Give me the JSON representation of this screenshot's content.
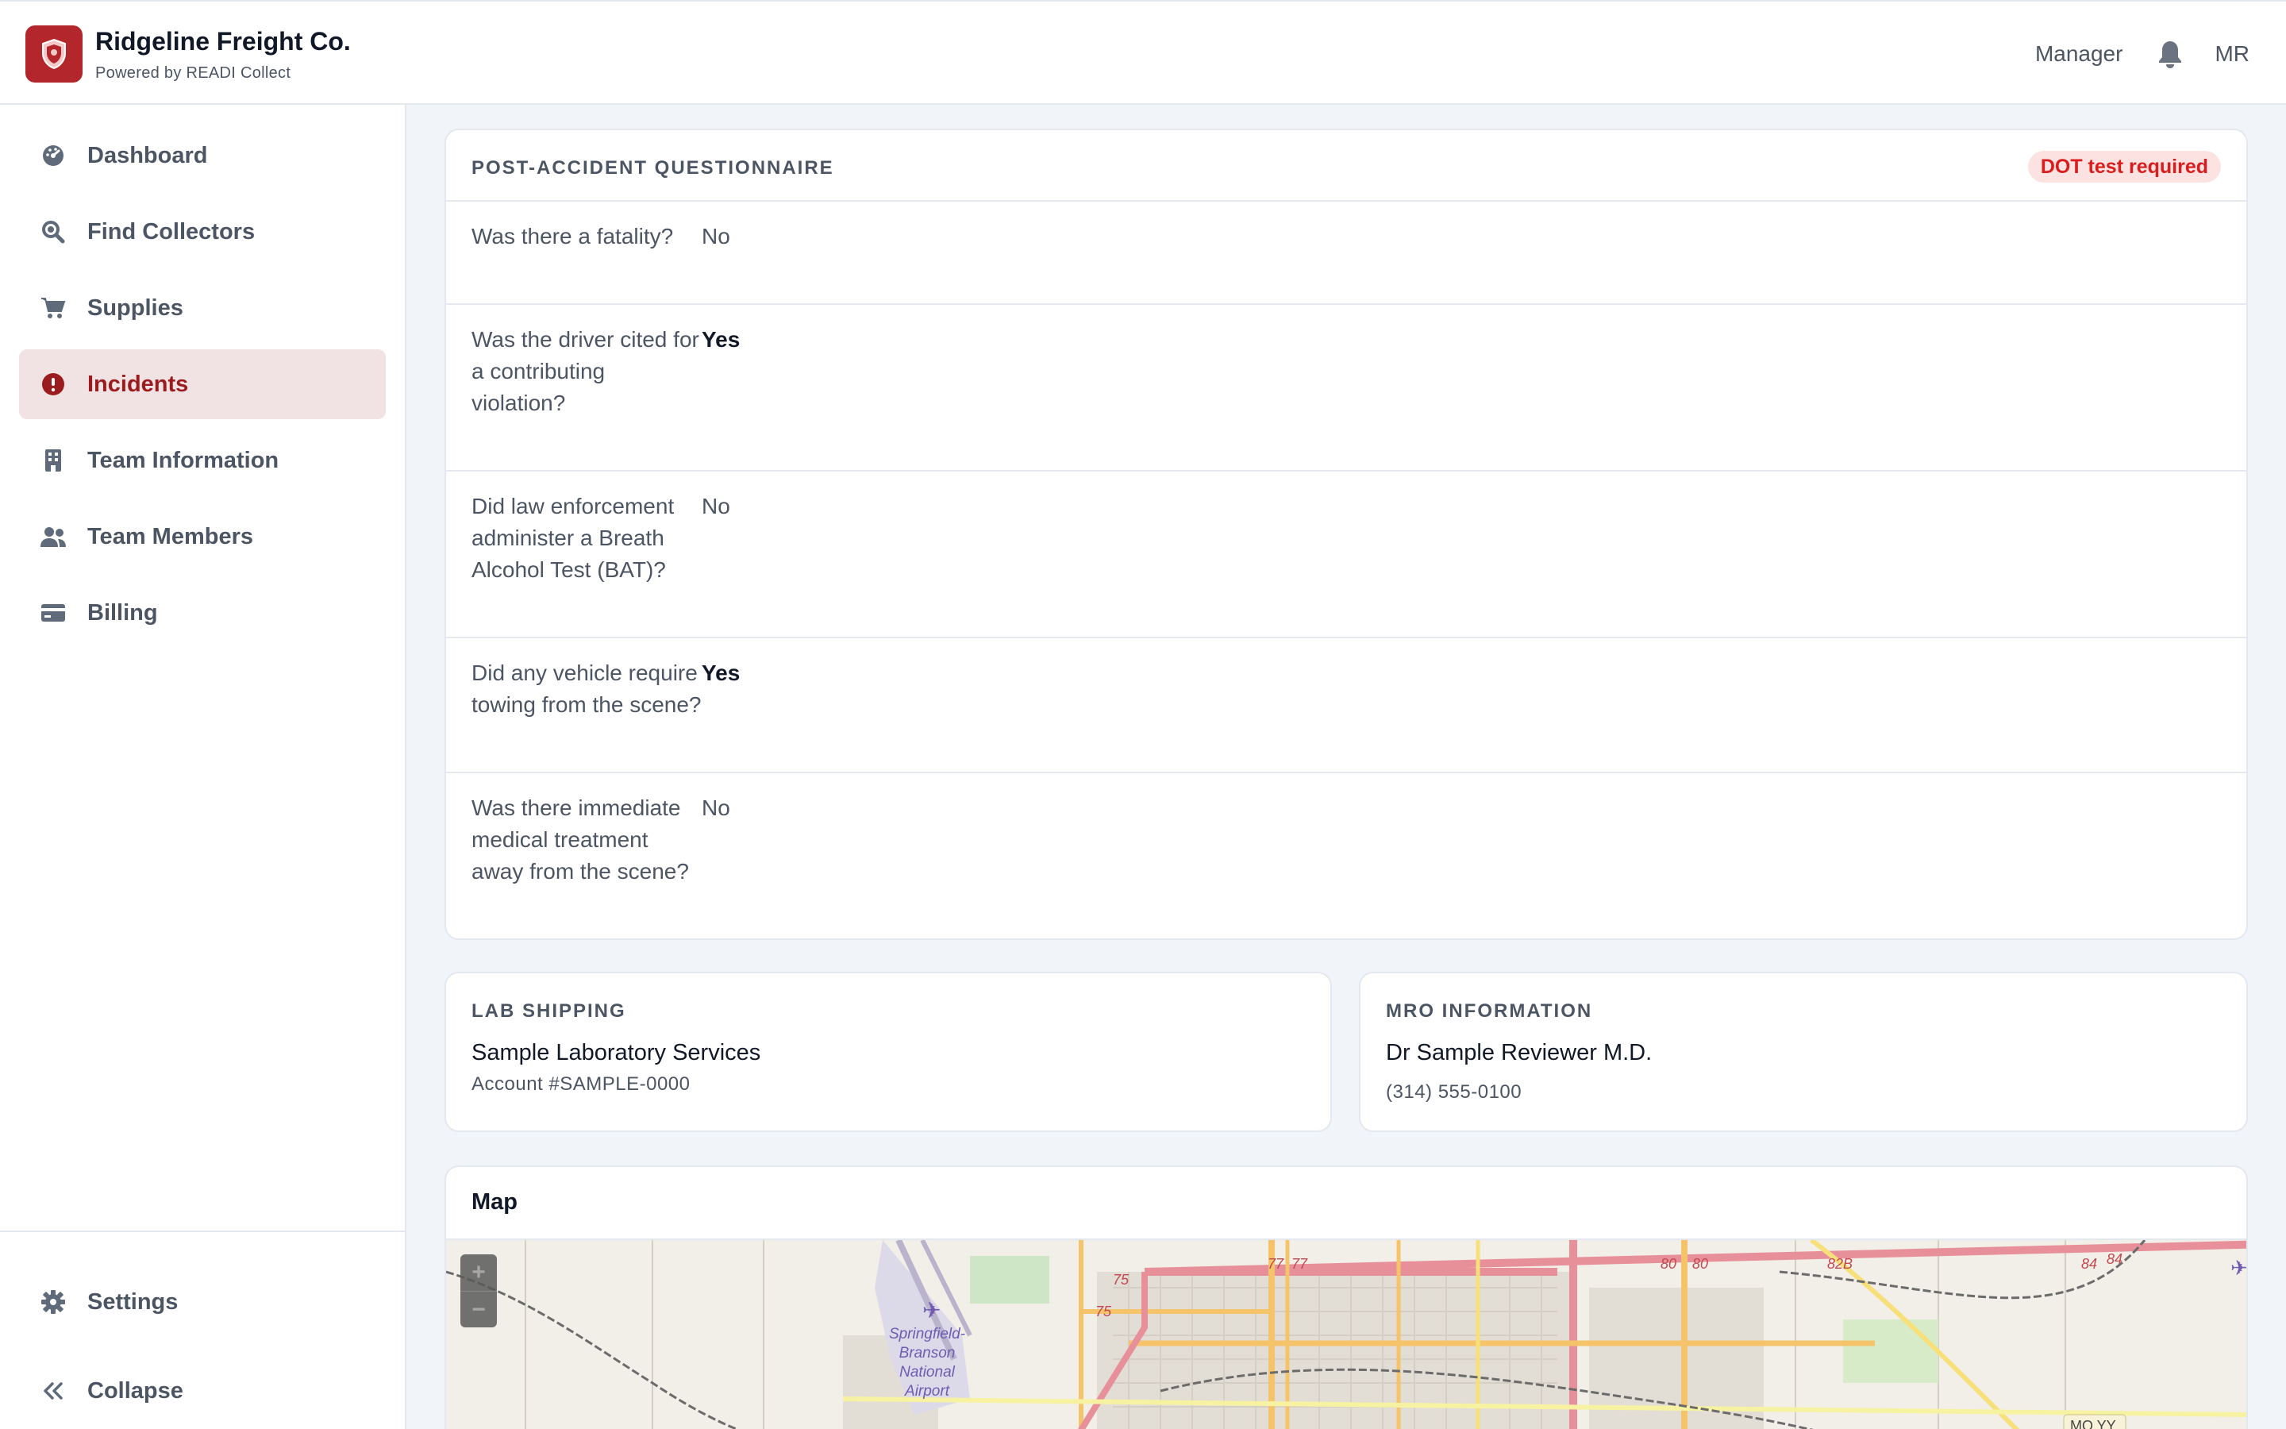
{
  "header": {
    "brand_title": "Ridgeline Freight Co.",
    "brand_subtitle": "Powered by READI Collect",
    "role": "Manager",
    "avatar_initials": "MR"
  },
  "sidebar": {
    "items": [
      {
        "label": "Dashboard",
        "icon": "dashboard-icon",
        "active": false
      },
      {
        "label": "Find Collectors",
        "icon": "search-icon",
        "active": false
      },
      {
        "label": "Supplies",
        "icon": "cart-icon",
        "active": false
      },
      {
        "label": "Incidents",
        "icon": "alert-icon",
        "active": true
      },
      {
        "label": "Team Information",
        "icon": "building-icon",
        "active": false
      },
      {
        "label": "Team Members",
        "icon": "users-icon",
        "active": false
      },
      {
        "label": "Billing",
        "icon": "credit-card-icon",
        "active": false
      }
    ],
    "settings_label": "Settings",
    "collapse_label": "Collapse"
  },
  "questionnaire": {
    "title": "POST-ACCIDENT QUESTIONNAIRE",
    "badge": "DOT test required",
    "rows": [
      {
        "question": "Was there a fatality?",
        "answer": "No"
      },
      {
        "question": "Was the driver cited for a contributing violation?",
        "answer": "Yes"
      },
      {
        "question": "Did law enforcement administer a Breath Alcohol Test (BAT)?",
        "answer": "No"
      },
      {
        "question": "Did any vehicle require towing from the scene?",
        "answer": "Yes"
      },
      {
        "question": "Was there immediate medical treatment away from the scene?",
        "answer": "No"
      }
    ]
  },
  "lab_shipping": {
    "label": "LAB SHIPPING",
    "name": "Sample Laboratory Services",
    "account": "Account #SAMPLE-0000"
  },
  "mro": {
    "label": "MRO INFORMATION",
    "name": "Dr Sample Reviewer M.D.",
    "phone": "(314) 555-0100"
  },
  "map": {
    "title": "Map",
    "zoom_in": "+",
    "zoom_out": "−",
    "airport_label": [
      "Springfield-",
      "Branson",
      "National",
      "Airport"
    ],
    "road_labels": [
      "77",
      "77",
      "75",
      "75",
      "80",
      "80",
      "82B",
      "84",
      "84",
      "MO YY"
    ]
  },
  "colors": {
    "accent": "#b3262b",
    "active_bg": "#f1e2e3",
    "badge_bg": "#fde2e2",
    "badge_text": "#d91c1c"
  }
}
